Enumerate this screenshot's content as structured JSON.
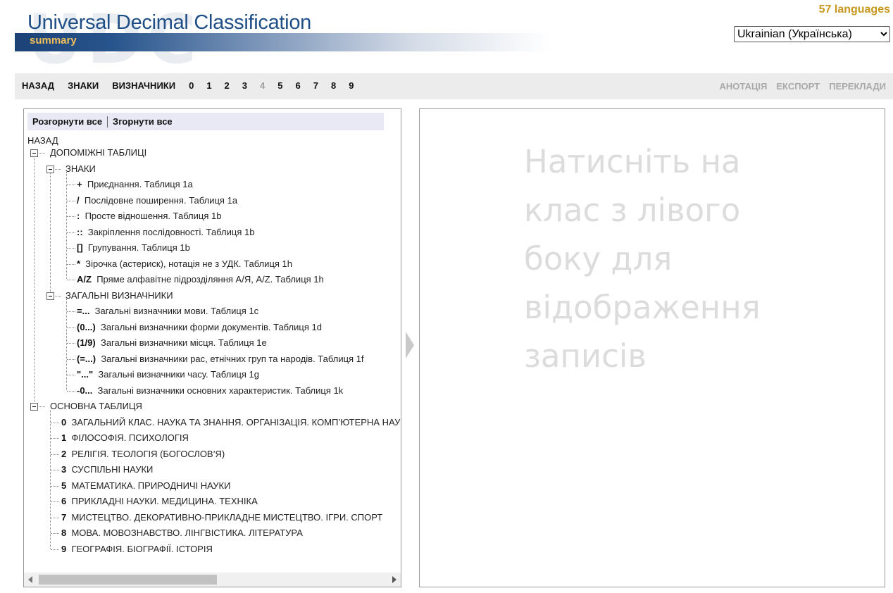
{
  "header": {
    "watermark": "UDC",
    "title": "Universal Decimal Classification",
    "subtitle": "summary",
    "languages_count": "57 languages",
    "language_selected": "Ukrainian (Українська)"
  },
  "nav": {
    "left": [
      "НАЗАД",
      "ЗНАКИ",
      "ВИЗНАЧНИКИ"
    ],
    "numbers": [
      "0",
      "1",
      "2",
      "3",
      "4",
      "5",
      "6",
      "7",
      "8",
      "9"
    ],
    "disabled_number": "4",
    "right": [
      "АНОТАЦІЯ",
      "ЕКСПОРТ",
      "ПЕРЕКЛАДИ"
    ]
  },
  "tree": {
    "expand_all": "Розгорнути все",
    "collapse_all": "Згорнути все",
    "back": "НАЗАД",
    "aux_root": "ДОПОМІЖНІ ТАБЛИЦІ",
    "signs": {
      "label": "ЗНАКИ",
      "items": [
        {
          "code": "+",
          "text": "Приєднання. Таблиця 1a"
        },
        {
          "code": "/",
          "text": "Послідовне поширення. Таблиця 1a"
        },
        {
          "code": ":",
          "text": "Просте відношення. Таблиця 1b"
        },
        {
          "code": "::",
          "text": "Закріплення послідовності. Таблиця 1b"
        },
        {
          "code": "[]",
          "text": "Групування. Таблиця 1b"
        },
        {
          "code": "*",
          "text": "Зірочка (астериск), нотація не з УДК. Таблиця 1h"
        },
        {
          "code": "A/Z",
          "text": "Пряме алфавітне підрозділяння А/Я, A/Z. Таблиця 1h"
        }
      ]
    },
    "common_aux": {
      "label": "ЗАГАЛЬНІ ВИЗНАЧНИКИ",
      "items": [
        {
          "code": "=...",
          "text": "Загальні визначники мови. Таблиця 1c"
        },
        {
          "code": "(0...)",
          "text": "Загальні визначники форми документів. Таблиця 1d"
        },
        {
          "code": "(1/9)",
          "text": "Загальні визначники місця. Таблиця 1e"
        },
        {
          "code": "(=...)",
          "text": "Загальні визначники рас, етнічних груп та народів. Таблиця 1f"
        },
        {
          "code": "\"...\"",
          "text": "Загальні визначники часу. Таблиця 1g"
        },
        {
          "code": "-0...",
          "text": "Загальні визначники основних характеристик. Таблиця 1k"
        }
      ]
    },
    "main_root": "ОСНОВНА ТАБЛИЦЯ",
    "main_items": [
      {
        "code": "0",
        "text": "ЗАГАЛЬНИЙ КЛАС. НАУКА ТА ЗНАННЯ. ОРГАНІЗАЦІЯ. КОМП’ЮТЕРНА НАУКА"
      },
      {
        "code": "1",
        "text": "ФІЛОСОФІЯ. ПСИХОЛОГІЯ"
      },
      {
        "code": "2",
        "text": "РЕЛІГІЯ. ТЕОЛОГІЯ (БОГОСЛОВ’Я)"
      },
      {
        "code": "3",
        "text": "СУСПІЛЬНІ НАУКИ"
      },
      {
        "code": "5",
        "text": "МАТЕМАТИКА. ПРИРОДНИЧІ НАУКИ"
      },
      {
        "code": "6",
        "text": "ПРИКЛАДНІ НАУКИ. МЕДИЦИНА. ТЕХНІКА"
      },
      {
        "code": "7",
        "text": "МИСТЕЦТВО. ДЕКОРАТИВНО-ПРИКЛАДНЕ МИСТЕЦТВО. ІГРИ. СПОРТ"
      },
      {
        "code": "8",
        "text": "МОВА. МОВОЗНАВСТВО. ЛІНГВІСТИКА. ЛІТЕРАТУРА"
      },
      {
        "code": "9",
        "text": "ГЕОГРАФІЯ. БІОГРАФІЇ. ІСТОРІЯ"
      }
    ]
  },
  "content": {
    "placeholder": "Натисніть на клас з лівого боку для відображення записів"
  },
  "colors": {
    "title_blue": "#1f4f87",
    "subtitle_gold": "#f2c05a",
    "languages_gold": "#c8981f",
    "navbar_bg": "#ececec",
    "toolbar_bg": "#e9e9f5",
    "placeholder_gray": "#dcdcdc"
  }
}
